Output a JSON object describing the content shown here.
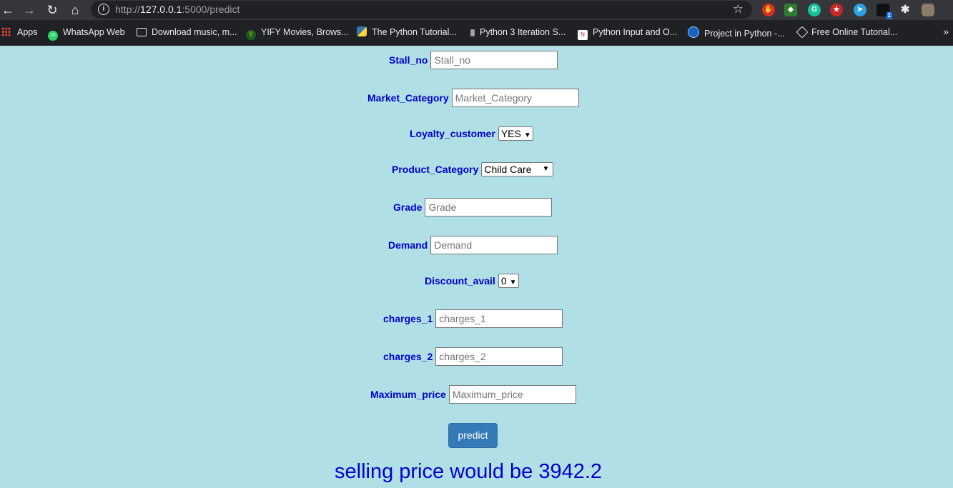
{
  "browser": {
    "url_prefix": "http://",
    "url_host": "127.0.0.1",
    "url_path": ":5000/predict",
    "bookmarks": [
      {
        "label": "Apps"
      },
      {
        "label": "WhatsApp Web"
      },
      {
        "label": "Download music, m..."
      },
      {
        "label": "YIFY Movies, Brows..."
      },
      {
        "label": "The Python Tutorial..."
      },
      {
        "label": "Python 3 Iteration S..."
      },
      {
        "label": "Python Input and O..."
      },
      {
        "label": "Project in Python -..."
      },
      {
        "label": "Free Online Tutorial..."
      }
    ],
    "extension_badge": "1",
    "whatsapp_badge": "24",
    "more_bookmarks": "»"
  },
  "form": {
    "stall_no": {
      "label": "Stall_no",
      "placeholder": "Stall_no",
      "value": ""
    },
    "market_category": {
      "label": "Market_Category",
      "placeholder": "Market_Category",
      "value": ""
    },
    "loyalty_customer": {
      "label": "Loyalty_customer",
      "selected": "YES"
    },
    "product_category": {
      "label": "Product_Category",
      "selected": "Child Care"
    },
    "grade": {
      "label": "Grade",
      "placeholder": "Grade",
      "value": ""
    },
    "demand": {
      "label": "Demand",
      "placeholder": "Demand",
      "value": ""
    },
    "discount_avail": {
      "label": "Discount_avail",
      "selected": "0"
    },
    "charges_1": {
      "label": "charges_1",
      "placeholder": "charges_1",
      "value": ""
    },
    "charges_2": {
      "label": "charges_2",
      "placeholder": "charges_2",
      "value": ""
    },
    "maximum_price": {
      "label": "Maximum_price",
      "placeholder": "Maximum_price",
      "value": ""
    },
    "submit_label": "predict"
  },
  "result_text": "selling price would be 3942.2"
}
